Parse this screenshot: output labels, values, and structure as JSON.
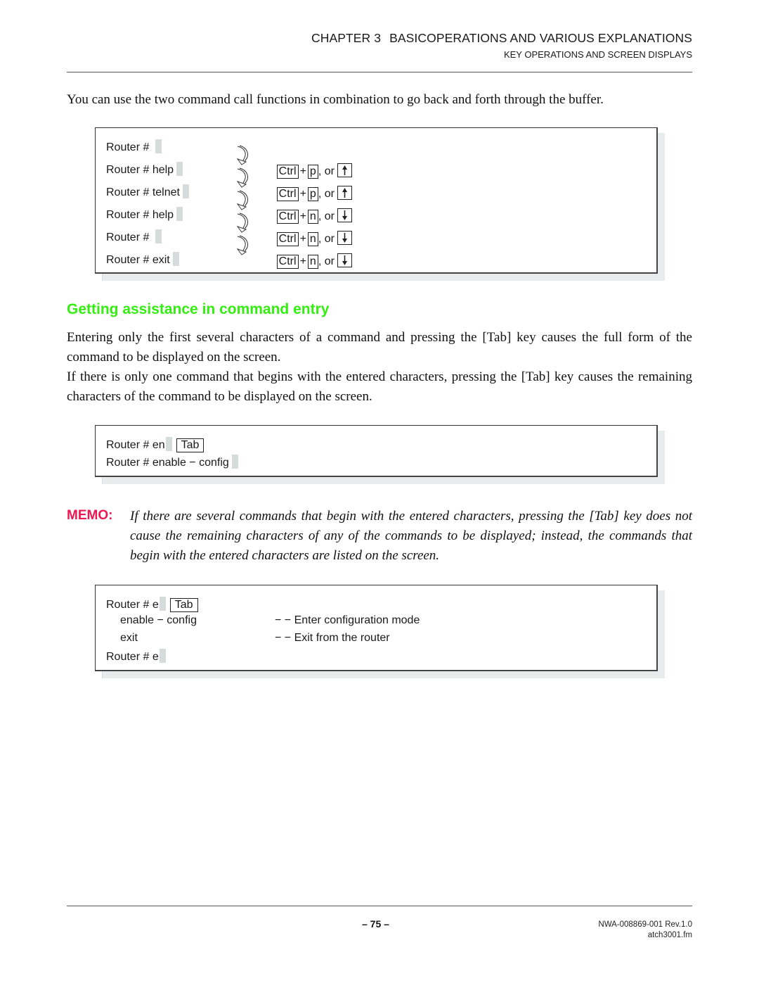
{
  "header": {
    "chapter_number": "CHAPTER 3",
    "chapter_title": "BASICOPERATIONS AND VARIOUS EXPLANATIONS",
    "section_title": "KEY OPERATIONS AND SCREEN DISPLAYS"
  },
  "intro_paragraph": "You can use the two command call functions in combination to go back and forth through the buffer.",
  "buffer_example": {
    "prompt_lines": [
      "Router # ",
      "Router # help",
      "Router # telnet",
      "Router # help",
      "Router # ",
      "Router # exit"
    ],
    "key_combos": [
      {
        "modifier": "Ctrl",
        "plus": "+",
        "key": "p",
        "or_text": ", or",
        "arrow": "up-arrow-icon"
      },
      {
        "modifier": "Ctrl",
        "plus": "+",
        "key": "p",
        "or_text": ", or",
        "arrow": "up-arrow-icon"
      },
      {
        "modifier": "Ctrl",
        "plus": "+",
        "key": "n",
        "or_text": ", or",
        "arrow": "down-arrow-icon"
      },
      {
        "modifier": "Ctrl",
        "plus": "+",
        "key": "n",
        "or_text": ", or",
        "arrow": "down-arrow-icon"
      },
      {
        "modifier": "Ctrl",
        "plus": "+",
        "key": "n",
        "or_text": ", or",
        "arrow": "down-arrow-icon"
      }
    ]
  },
  "section_heading": "Getting assistance in command entry",
  "tab_paragraph_1": "Entering only the first several characters of a command and pressing the [Tab] key causes the full form of the command to be displayed on the screen.",
  "tab_paragraph_2": "If there is only one command that begins with the entered characters, pressing the [Tab] key causes the remaining characters of the command to be displayed on the screen.",
  "completion_example": {
    "line1_prompt": "Router # en",
    "line1_key": "Tab",
    "line2": "Router # enable − config"
  },
  "memo": {
    "label": "MEMO:",
    "text": "If there are several commands that begin with the entered characters, pressing the [Tab] key does not cause the remaining characters of any of the commands to be displayed; instead, the commands that begin with the entered characters are listed on the screen."
  },
  "listing_example": {
    "line1_prompt": "Router # e",
    "line1_key": "Tab",
    "commands": [
      {
        "name": "enable − config",
        "description": "− − Enter configuration mode"
      },
      {
        "name": "exit",
        "description": "− − Exit from the router"
      }
    ],
    "last_line": "Router # e"
  },
  "footer": {
    "page_number": "– 75 –",
    "doc_number": "NWA-008869-001 Rev.1.0",
    "file_name": "atch3001.fm"
  },
  "colors": {
    "heading_green": "#33ee10",
    "memo_red": "#ee1650",
    "cursor_grey": "#d6dcdc",
    "box_shadow": "#e8eced"
  }
}
